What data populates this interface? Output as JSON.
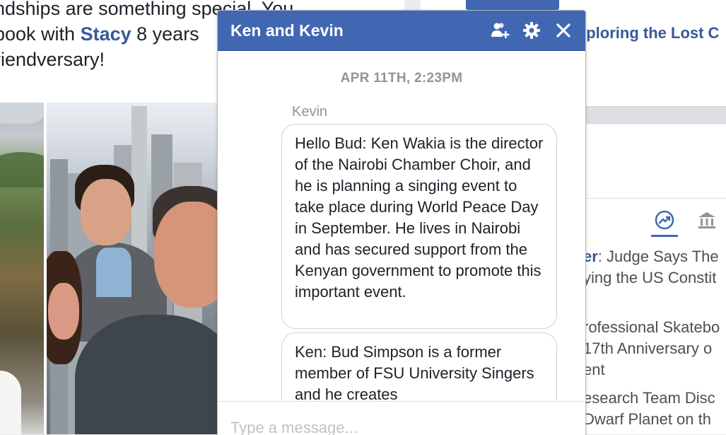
{
  "feed": {
    "memory_line1": "ndships are something special. You",
    "memory_line2_prefix": "book with ",
    "memory_friend": "Stacy",
    "memory_line2_suffix": " 8 years",
    "memory_line3": "riendversary!"
  },
  "right": {
    "link_text": "xploring the Lost C",
    "trending": [
      {
        "keyword": "er",
        "text": ": Judge Says The"
      },
      {
        "keyword": "",
        "text": "ying the US Constit"
      },
      {
        "keyword": "",
        "text": "rofessional Skatebo"
      },
      {
        "keyword": "",
        "text": "17th Anniversary o"
      },
      {
        "keyword": "",
        "text": "ent"
      },
      {
        "keyword": "",
        "text": "esearch Team Disc"
      },
      {
        "keyword": "",
        "text": "Dwarf Planet on th"
      }
    ],
    "tab_icons": [
      "trending-icon",
      "politics-icon"
    ]
  },
  "chat": {
    "title": "Ken and Kevin",
    "header_icons": [
      "add-person-icon",
      "gear-icon",
      "close-icon"
    ],
    "timestamp": "APR 11TH, 2:23PM",
    "sender": "Kevin",
    "messages": [
      "Hello Bud: Ken Wakia is the director of the Nairobi Chamber Choir, and he is planning a singing event to take place during World Peace Day in September.  He lives in Nairobi and has secured support from the Kenyan government to promote this important event.",
      "Ken: Bud Simpson is a former member of FSU University Singers and he creates"
    ],
    "composer_placeholder": "Type a message..."
  },
  "colors": {
    "header_blue": "#4267b2",
    "link_blue": "#385898",
    "meta_gray": "#90949c",
    "text": "#1d2129"
  }
}
